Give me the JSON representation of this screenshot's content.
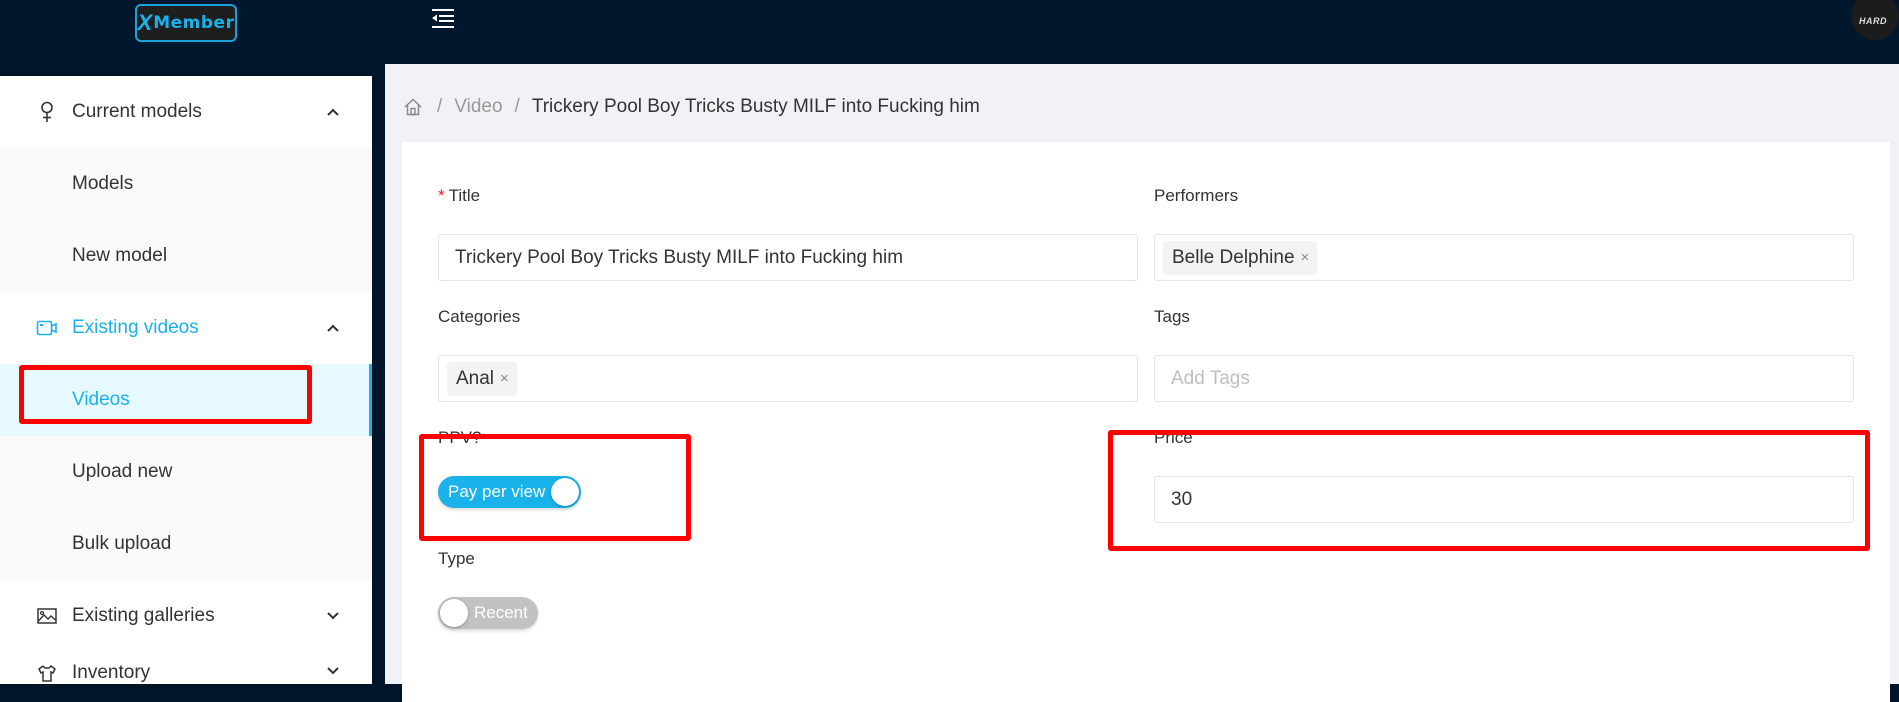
{
  "header": {
    "logo_mark": "X",
    "logo_text": "Member",
    "avatar_text": "HARD"
  },
  "sidebar": {
    "groups": [
      {
        "label": "Current models",
        "icon": "female-icon",
        "expanded": true,
        "items": [
          {
            "label": "Models"
          },
          {
            "label": "New model"
          }
        ]
      },
      {
        "label": "Existing videos",
        "icon": "video-camera-icon",
        "expanded": true,
        "active": true,
        "items": [
          {
            "label": "Videos",
            "selected": true
          },
          {
            "label": "Upload new"
          },
          {
            "label": "Bulk upload"
          }
        ]
      },
      {
        "label": "Existing galleries",
        "icon": "picture-icon",
        "expanded": false
      },
      {
        "label": "Inventory",
        "icon": "shirt-icon",
        "expanded": false
      }
    ]
  },
  "breadcrumb": {
    "home_icon": "home-icon",
    "separator": "/",
    "items": [
      "Video",
      "Trickery Pool Boy Tricks Busty MILF into Fucking him"
    ]
  },
  "form": {
    "title": {
      "required_mark": "*",
      "label": "Title",
      "value": "Trickery Pool Boy Tricks Busty MILF into Fucking him"
    },
    "performers": {
      "label": "Performers",
      "tags": [
        "Belle Delphine"
      ],
      "remove_glyph": "×"
    },
    "categories": {
      "label": "Categories",
      "tags": [
        "Anal"
      ],
      "remove_glyph": "×"
    },
    "tags": {
      "label": "Tags",
      "placeholder": "Add Tags"
    },
    "ppv": {
      "label": "PPV?",
      "switch_label": "Pay per view",
      "checked": true
    },
    "price": {
      "label": "Price",
      "value": "30"
    },
    "type": {
      "label": "Type",
      "switch_label": "Recent",
      "checked": false
    }
  },
  "colors": {
    "accent": "#1ab2ea",
    "header_bg": "#00172d",
    "highlight": "#ff0000",
    "required": "#f5222d"
  }
}
